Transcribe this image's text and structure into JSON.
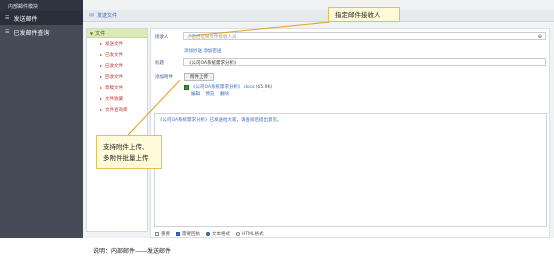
{
  "sidebar": {
    "title": "内部邮件模块",
    "items": [
      {
        "label": "发送邮件"
      },
      {
        "label": "已发邮件查询"
      }
    ]
  },
  "header": {
    "title": "发送文件"
  },
  "folders": {
    "root": "文件",
    "items": [
      "发送文件",
      "已发文件",
      "已收文件",
      "回收文件",
      "草稿文件",
      "文件收藏",
      "文件查询库"
    ]
  },
  "form": {
    "recipient_label": "接收人",
    "recipient_placeholder": "点击后选择文件接收人员",
    "add_cc": "添加抄送",
    "add_bcc": "添加密送",
    "subject_label": "标题",
    "subject_value": "《公司OA系统需求分析》",
    "attachment_label": "添加附件",
    "upload_button": "附件上传",
    "attachment_name": "《公司OA系统需求分析》.docx",
    "attachment_size": "(65.9K)",
    "attachment_actions": [
      "编辑",
      "预览",
      "删除"
    ],
    "body_text": "《公司OA系统需求分析》已发送给大家，请查阅后提出意见。",
    "options": [
      "重要",
      "需要回执",
      "文本格式",
      "HTML格式"
    ]
  },
  "callouts": [
    "指定邮件接收人",
    "支持附件上传、",
    "多附件批量上传"
  ],
  "caption": "说明：内部邮件——发送邮件"
}
